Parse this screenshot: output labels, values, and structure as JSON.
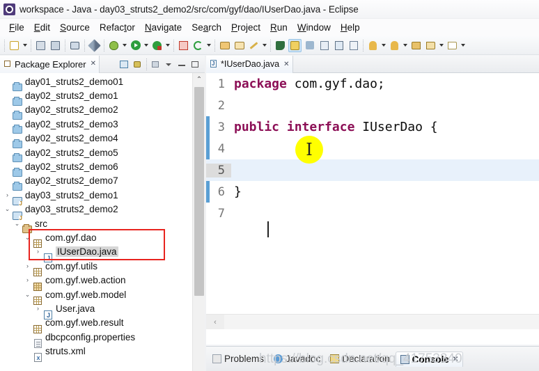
{
  "window": {
    "title": "workspace - Java - day03_struts2_demo2/src/com/gyf/dao/IUserDao.java - Eclipse",
    "logo_icon": "eclipse-logo-icon"
  },
  "menubar": [
    {
      "label": "File",
      "mnemonic": "F"
    },
    {
      "label": "Edit",
      "mnemonic": "E"
    },
    {
      "label": "Source",
      "mnemonic": "S"
    },
    {
      "label": "Refactor",
      "mnemonic": "t"
    },
    {
      "label": "Navigate",
      "mnemonic": "N"
    },
    {
      "label": "Search",
      "mnemonic": "a"
    },
    {
      "label": "Project",
      "mnemonic": "P"
    },
    {
      "label": "Run",
      "mnemonic": "R"
    },
    {
      "label": "Window",
      "mnemonic": "W"
    },
    {
      "label": "Help",
      "mnemonic": "H"
    }
  ],
  "toolbar": {
    "items": [
      "new-wizard-icon",
      "new-dropdown-arrow",
      "save-icon",
      "save-all-icon",
      "print-icon",
      "pencil-icon",
      "debug-icon",
      "debug-dropdown-arrow",
      "run-icon",
      "run-dropdown-arrow",
      "external-tools-icon",
      "external-tools-dropdown-arrow",
      "coverage-icon",
      "refresh-icon",
      "refresh-dropdown-arrow",
      "open-type-icon",
      "open-resource-icon",
      "wand-icon",
      "wand-dropdown-arrow",
      "perspective-icon",
      "java-perspective-icon",
      "next-annotation-icon",
      "document-icon-1",
      "document-icon-2",
      "document-icon-3",
      "previous-edit-icon",
      "previous-edit-dropdown-arrow",
      "next-edit-icon",
      "next-edit-dropdown-arrow",
      "back-icon",
      "forward-icon",
      "forward-dropdown-arrow",
      "forward-outline-icon",
      "forward-outline-dropdown-arrow"
    ]
  },
  "package_explorer": {
    "tab_label": "Package Explorer",
    "tab_icon": "package-explorer-icon",
    "close_icon": "close-icon",
    "tools": [
      "collapse-all-icon",
      "link-with-editor-icon",
      "focus-on-active-task-icon",
      "view-menu-icon",
      "minimize-icon",
      "maximize-icon"
    ],
    "scrollbar": {
      "up_arrow": "scroll-up-arrow"
    },
    "tree": [
      {
        "label": "day01_struts2_demo01",
        "indent": 1,
        "twisty": "",
        "icon": "closed-project-folder-icon",
        "selected": false
      },
      {
        "label": "day02_struts2_demo1",
        "indent": 1,
        "twisty": "",
        "icon": "closed-project-folder-icon",
        "selected": false
      },
      {
        "label": "day02_struts2_demo2",
        "indent": 1,
        "twisty": "",
        "icon": "closed-project-folder-icon",
        "selected": false
      },
      {
        "label": "day02_struts2_demo3",
        "indent": 1,
        "twisty": "",
        "icon": "closed-project-folder-icon",
        "selected": false
      },
      {
        "label": "day02_struts2_demo4",
        "indent": 1,
        "twisty": "",
        "icon": "closed-project-folder-icon",
        "selected": false
      },
      {
        "label": "day02_struts2_demo5",
        "indent": 1,
        "twisty": "",
        "icon": "closed-project-folder-icon",
        "selected": false
      },
      {
        "label": "day02_struts2_demo6",
        "indent": 1,
        "twisty": "",
        "icon": "closed-project-folder-icon",
        "selected": false
      },
      {
        "label": "day02_struts2_demo7",
        "indent": 1,
        "twisty": "",
        "icon": "closed-project-folder-icon",
        "selected": false
      },
      {
        "label": "day03_struts2_demo1",
        "indent": 1,
        "twisty": "›",
        "icon": "java-project-icon",
        "selected": false
      },
      {
        "label": "day03_struts2_demo2",
        "indent": 1,
        "twisty": "⌄",
        "icon": "java-project-icon",
        "selected": false
      },
      {
        "label": "src",
        "indent": 2,
        "twisty": "⌄",
        "icon": "source-folder-icon",
        "selected": false
      },
      {
        "label": "com.gyf.dao",
        "indent": 3,
        "twisty": "⌄",
        "icon": "package-icon",
        "selected": false
      },
      {
        "label": "IUserDao.java",
        "indent": 4,
        "twisty": "›",
        "icon": "java-file-icon",
        "selected": true
      },
      {
        "label": "com.gyf.utils",
        "indent": 3,
        "twisty": "›",
        "icon": "package-icon",
        "selected": false
      },
      {
        "label": "com.gyf.web.action",
        "indent": 3,
        "twisty": "›",
        "icon": "package-icon-shaded",
        "selected": false
      },
      {
        "label": "com.gyf.web.model",
        "indent": 3,
        "twisty": "⌄",
        "icon": "package-icon",
        "selected": false
      },
      {
        "label": "User.java",
        "indent": 4,
        "twisty": "›",
        "icon": "java-file-icon",
        "selected": false
      },
      {
        "label": "com.gyf.web.result",
        "indent": 3,
        "twisty": "",
        "icon": "package-icon",
        "selected": false
      },
      {
        "label": "dbcpconfig.properties",
        "indent": 3,
        "twisty": "",
        "icon": "properties-file-icon",
        "selected": false
      },
      {
        "label": "struts.xml",
        "indent": 3,
        "twisty": "",
        "icon": "xml-file-icon",
        "selected": false
      }
    ],
    "highlight_box_color": "#e8241f"
  },
  "editor": {
    "tab_label": "*IUserDao.java",
    "tab_icon": "java-file-icon",
    "close_icon": "close-icon",
    "keyword_color": "#8c0f56",
    "current_line": 5,
    "lines": [
      {
        "number": "1",
        "tokens": [
          {
            "t": "package",
            "kw": true
          },
          {
            "t": " com.gyf.dao;",
            "kw": false
          }
        ]
      },
      {
        "number": "2",
        "tokens": []
      },
      {
        "number": "3",
        "tokens": [
          {
            "t": "public",
            "kw": true
          },
          {
            "t": " ",
            "kw": false
          },
          {
            "t": "interface",
            "kw": true
          },
          {
            "t": " IUserDao {",
            "kw": false
          }
        ]
      },
      {
        "number": "4",
        "tokens": []
      },
      {
        "number": "5",
        "tokens": []
      },
      {
        "number": "6",
        "tokens": [
          {
            "t": "}",
            "kw": false
          }
        ]
      },
      {
        "number": "7",
        "tokens": []
      }
    ],
    "hscroll_left_arrow": "‹"
  },
  "bottom_panel": {
    "tabs": [
      {
        "label": "Problems",
        "icon": "problems-icon",
        "active": false
      },
      {
        "label": "Javadoc",
        "icon": "javadoc-icon",
        "active": false
      },
      {
        "label": "Declaration",
        "icon": "declaration-icon",
        "active": false
      },
      {
        "label": "Console",
        "icon": "console-icon",
        "active": true,
        "close_icon": "close-icon"
      }
    ]
  },
  "watermark": {
    "text": "https://blog.csdn.net/qq_41753340"
  },
  "cursor": {
    "glyph": "I",
    "highlight_color": "#ffff00"
  }
}
